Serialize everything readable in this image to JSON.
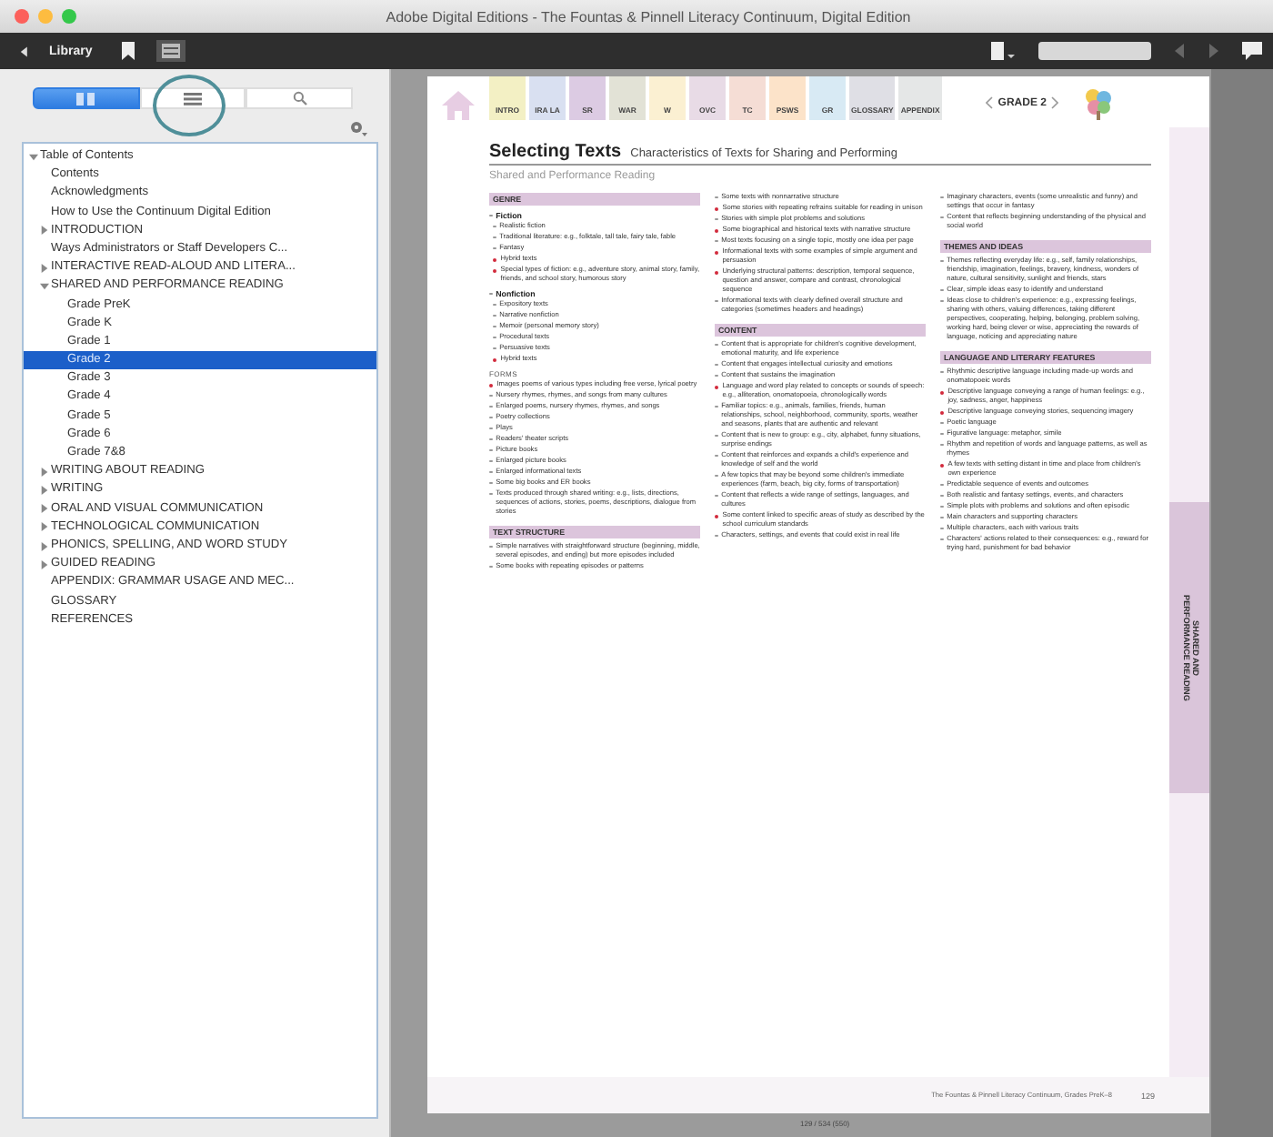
{
  "window": {
    "title": "Adobe Digital Editions - The Fountas & Pinnell Literacy Continuum, Digital Edition"
  },
  "toolbar": {
    "library_label": "Library"
  },
  "sidebar": {
    "segments": [
      {
        "kind": "thumbnails",
        "selected": true
      },
      {
        "kind": "list",
        "selected": false
      },
      {
        "kind": "search",
        "selected": false
      }
    ],
    "toc": [
      {
        "label": "Table of Contents",
        "expanded": true,
        "selected": false,
        "children": [
          {
            "label": "Contents",
            "selected": false
          },
          {
            "label": "Acknowledgments",
            "selected": false
          },
          {
            "label": "How to Use the Continuum Digital Edition",
            "selected": false
          },
          {
            "label": "INTRODUCTION",
            "expanded": false,
            "selected": false
          },
          {
            "label": "Ways Administrators or Staff Developers C...",
            "selected": false
          },
          {
            "label": "INTERACTIVE READ-ALOUD AND LITERA...",
            "expanded": false,
            "selected": false
          },
          {
            "label": "SHARED AND PERFORMANCE READING",
            "expanded": true,
            "selected": false,
            "children": [
              {
                "label": "Grade PreK",
                "selected": false
              },
              {
                "label": "Grade K",
                "selected": false
              },
              {
                "label": "Grade 1",
                "selected": false
              },
              {
                "label": "Grade 2",
                "selected": true
              },
              {
                "label": "Grade 3",
                "selected": false
              },
              {
                "label": "Grade 4",
                "selected": false
              },
              {
                "label": "Grade 5",
                "selected": false
              },
              {
                "label": "Grade 6",
                "selected": false
              },
              {
                "label": "Grade 7&8",
                "selected": false
              }
            ]
          },
          {
            "label": "WRITING ABOUT READING",
            "expanded": false,
            "selected": false
          },
          {
            "label": "WRITING",
            "expanded": false,
            "selected": false
          },
          {
            "label": "ORAL AND VISUAL COMMUNICATION",
            "expanded": false,
            "selected": false
          },
          {
            "label": "TECHNOLOGICAL COMMUNICATION",
            "expanded": false,
            "selected": false
          },
          {
            "label": "PHONICS, SPELLING, AND WORD STUDY",
            "expanded": false,
            "selected": false
          },
          {
            "label": "GUIDED READING",
            "expanded": false,
            "selected": false
          },
          {
            "label": "APPENDIX: GRAMMAR USAGE AND MEC...",
            "selected": false
          },
          {
            "label": "GLOSSARY",
            "selected": false
          },
          {
            "label": "REFERENCES",
            "selected": false
          }
        ]
      }
    ]
  },
  "page": {
    "tabs": [
      {
        "label": "INTRO",
        "color": "#f3f0c4"
      },
      {
        "label": "IRA LA",
        "color": "#d9e0f1"
      },
      {
        "label": "SR",
        "color": "#dccbe3"
      },
      {
        "label": "WAR",
        "color": "#e2e2d6"
      },
      {
        "label": "W",
        "color": "#fbf0d2"
      },
      {
        "label": "OVC",
        "color": "#e8dbe6"
      },
      {
        "label": "TC",
        "color": "#f5ddd5"
      },
      {
        "label": "PSWS",
        "color": "#fce3c9"
      },
      {
        "label": "GR",
        "color": "#d8eaf4"
      },
      {
        "label": "GLOSSARY",
        "color": "#dfdfe5"
      },
      {
        "label": "APPENDIX",
        "color": "#e5e7e7"
      }
    ],
    "grade": "GRADE 2",
    "title": "Selecting Texts",
    "subtitle": "Characteristics of Texts for Sharing and Performing",
    "section": "Shared and Performance Reading",
    "columns": [
      [
        {
          "kind": "heading",
          "text": "GENRE"
        },
        {
          "kind": "subhead",
          "text": "Fiction"
        },
        {
          "kind": "subitem",
          "text": "Realistic fiction",
          "emphasis": false
        },
        {
          "kind": "subitem",
          "text": "Traditional literature: e.g., folktale, tall tale, fairy tale, fable",
          "emphasis": false
        },
        {
          "kind": "subitem",
          "text": "Fantasy",
          "emphasis": false
        },
        {
          "kind": "subitem",
          "text": "Hybrid texts",
          "emphasis": true
        },
        {
          "kind": "subitem",
          "text": "Special types of fiction: e.g., adventure story, animal story, family, friends, and school story, humorous story",
          "emphasis": true
        },
        {
          "kind": "subhead",
          "text": "Nonfiction"
        },
        {
          "kind": "subitem",
          "text": "Expository texts",
          "emphasis": false
        },
        {
          "kind": "subitem",
          "text": "Narrative nonfiction",
          "emphasis": false
        },
        {
          "kind": "subitem",
          "text": "Memoir (personal memory story)",
          "emphasis": false
        },
        {
          "kind": "subitem",
          "text": "Procedural texts",
          "emphasis": false
        },
        {
          "kind": "subitem",
          "text": "Persuasive texts",
          "emphasis": false
        },
        {
          "kind": "subitem",
          "text": "Hybrid texts",
          "emphasis": true
        },
        {
          "kind": "label",
          "text": "FORMS"
        },
        {
          "kind": "bullet",
          "text": "Images poems of various types including free verse, lyrical poetry",
          "emphasis": true
        },
        {
          "kind": "bullet",
          "text": "Nursery rhymes, rhymes, and songs from many cultures",
          "emphasis": false
        },
        {
          "kind": "bullet",
          "text": "Enlarged poems, nursery rhymes, rhymes, and songs",
          "emphasis": false
        },
        {
          "kind": "bullet",
          "text": "Poetry collections",
          "emphasis": false
        },
        {
          "kind": "bullet",
          "text": "Plays",
          "emphasis": false
        },
        {
          "kind": "bullet",
          "text": "Readers' theater scripts",
          "emphasis": false
        },
        {
          "kind": "bullet",
          "text": "Picture books",
          "emphasis": false
        },
        {
          "kind": "bullet",
          "text": "Enlarged picture books",
          "emphasis": false
        },
        {
          "kind": "bullet",
          "text": "Enlarged informational texts",
          "emphasis": false
        },
        {
          "kind": "bullet",
          "text": "Some big books and ER books",
          "emphasis": false
        },
        {
          "kind": "bullet",
          "text": "Texts produced through shared writing: e.g., lists, directions, sequences of actions, stories, poems, descriptions, dialogue from stories",
          "emphasis": false
        },
        {
          "kind": "heading",
          "text": "TEXT STRUCTURE"
        },
        {
          "kind": "bullet",
          "text": "Simple narratives with straightforward structure (beginning, middle, several episodes, and ending) but more episodes included",
          "emphasis": false
        },
        {
          "kind": "bullet",
          "text": "Some books with repeating episodes or patterns",
          "emphasis": false
        }
      ],
      [
        {
          "kind": "bullet",
          "text": "Some texts with nonnarrative structure",
          "emphasis": false
        },
        {
          "kind": "bullet",
          "text": "Some stories with repeating refrains suitable for reading in unison",
          "emphasis": true
        },
        {
          "kind": "bullet",
          "text": "Stories with simple plot problems and solutions",
          "emphasis": false
        },
        {
          "kind": "bullet",
          "text": "Some biographical and historical texts with narrative structure",
          "emphasis": true
        },
        {
          "kind": "bullet",
          "text": "Most texts focusing on a single topic, mostly one idea per page",
          "emphasis": false
        },
        {
          "kind": "bullet",
          "text": "Informational texts with some examples of simple argument and persuasion",
          "emphasis": true
        },
        {
          "kind": "bullet",
          "text": "Underlying structural patterns: description, temporal sequence, question and answer, compare and contrast, chronological sequence",
          "emphasis": true
        },
        {
          "kind": "bullet",
          "text": "Informational texts with clearly defined overall structure and categories (sometimes headers and headings)",
          "emphasis": false
        },
        {
          "kind": "heading",
          "text": "CONTENT"
        },
        {
          "kind": "bullet",
          "text": "Content that is appropriate for children's cognitive development, emotional maturity, and life experience",
          "emphasis": false
        },
        {
          "kind": "bullet",
          "text": "Content that engages intellectual curiosity and emotions",
          "emphasis": false
        },
        {
          "kind": "bullet",
          "text": "Content that sustains the imagination",
          "emphasis": false
        },
        {
          "kind": "bullet",
          "text": "Language and word play related to concepts or sounds of speech: e.g., alliteration, onomatopoeia, chronologically words",
          "emphasis": true
        },
        {
          "kind": "bullet",
          "text": "Familiar topics: e.g., animals, families, friends, human relationships, school, neighborhood, community, sports, weather and seasons, plants that are authentic and relevant",
          "emphasis": false
        },
        {
          "kind": "bullet",
          "text": "Content that is new to group: e.g., city, alphabet, funny situations, surprise endings",
          "emphasis": false
        },
        {
          "kind": "bullet",
          "text": "Content that reinforces and expands a child's experience and knowledge of self and the world",
          "emphasis": false
        },
        {
          "kind": "bullet",
          "text": "A few topics that may be beyond some children's immediate experiences (farm, beach, big city, forms of transportation)",
          "emphasis": false
        },
        {
          "kind": "bullet",
          "text": "Content that reflects a wide range of settings, languages, and cultures",
          "emphasis": false
        },
        {
          "kind": "bullet",
          "text": "Some content linked to specific areas of study as described by the school curriculum standards",
          "emphasis": true
        },
        {
          "kind": "bullet",
          "text": "Characters, settings, and events that could exist in real life",
          "emphasis": false
        }
      ],
      [
        {
          "kind": "bullet",
          "text": "Imaginary characters, events (some unrealistic and funny) and settings that occur in fantasy",
          "emphasis": false
        },
        {
          "kind": "bullet",
          "text": "Content that reflects beginning understanding of the physical and social world",
          "emphasis": false
        },
        {
          "kind": "heading",
          "text": "THEMES AND IDEAS"
        },
        {
          "kind": "bullet",
          "text": "Themes reflecting everyday life: e.g., self, family relationships, friendship, imagination, feelings, bravery, kindness, wonders of nature, cultural sensitivity, sunlight and friends, stars",
          "emphasis": false
        },
        {
          "kind": "bullet",
          "text": "Clear, simple ideas easy to identify and understand",
          "emphasis": false
        },
        {
          "kind": "bullet",
          "text": "Ideas close to children's experience: e.g., expressing feelings, sharing with others, valuing differences, taking different perspectives, cooperating, helping, belonging, problem solving, working hard, being clever or wise, appreciating the rewards of language, noticing and appreciating nature",
          "emphasis": false
        },
        {
          "kind": "heading",
          "text": "LANGUAGE AND LITERARY FEATURES"
        },
        {
          "kind": "bullet",
          "text": "Rhythmic descriptive language including made-up words and onomatopoeic words",
          "emphasis": false
        },
        {
          "kind": "bullet",
          "text": "Descriptive language conveying a range of human feelings: e.g., joy, sadness, anger, happiness",
          "emphasis": true
        },
        {
          "kind": "bullet",
          "text": "Descriptive language conveying stories, sequencing imagery",
          "emphasis": true
        },
        {
          "kind": "bullet",
          "text": "Poetic language",
          "emphasis": false
        },
        {
          "kind": "bullet",
          "text": "Figurative language: metaphor, simile",
          "emphasis": false
        },
        {
          "kind": "bullet",
          "text": "Rhythm and repetition of words and language patterns, as well as rhymes",
          "emphasis": false
        },
        {
          "kind": "bullet",
          "text": "A few texts with setting distant in time and place from children's own experience",
          "emphasis": true
        },
        {
          "kind": "bullet",
          "text": "Predictable sequence of events and outcomes",
          "emphasis": false
        },
        {
          "kind": "bullet",
          "text": "Both realistic and fantasy settings, events, and characters",
          "emphasis": false
        },
        {
          "kind": "bullet",
          "text": "Simple plots with problems and solutions and often episodic",
          "emphasis": false
        },
        {
          "kind": "bullet",
          "text": "Main characters and supporting characters",
          "emphasis": false
        },
        {
          "kind": "bullet",
          "text": "Multiple characters, each with various traits",
          "emphasis": false
        },
        {
          "kind": "bullet",
          "text": "Characters' actions related to their consequences: e.g., reward for trying hard, punishment for bad behavior",
          "emphasis": false
        }
      ]
    ],
    "side_tab": [
      "SHARED AND",
      "PERFORMANCE READING"
    ],
    "footer": "The Fountas & Pinnell Literacy Continuum, Grades PreK–8",
    "page_number": "129"
  },
  "page_indicator": "129 / 534 (550)"
}
